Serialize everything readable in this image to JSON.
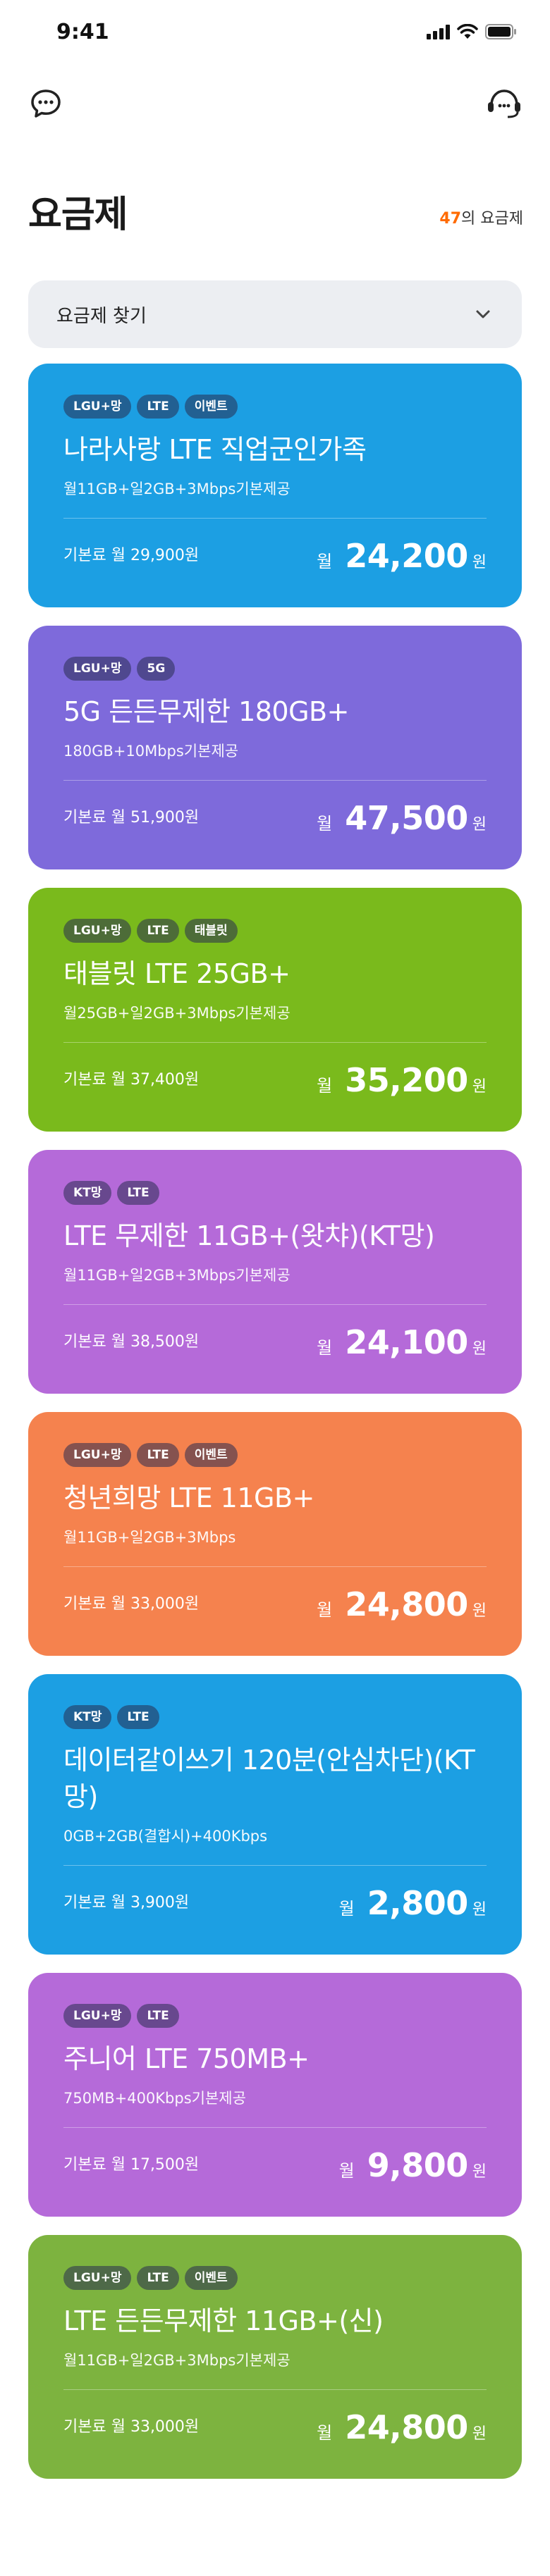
{
  "status_bar": {
    "time": "9:41"
  },
  "header": {
    "title": "요금제",
    "count_number": "47",
    "count_suffix": "의 요금제",
    "chat_icon": "chat-bubble-icon",
    "support_icon": "headset-icon"
  },
  "search": {
    "label": "요금제 찾기",
    "icon": "chevron-down-icon"
  },
  "colors": {
    "blue": "#1c9fe3",
    "purple": "#7e6adb",
    "green": "#7aba1c",
    "violet": "#b56ad9",
    "orange": "#f5824e",
    "olive": "#7db33f",
    "accent": "#ff6b00"
  },
  "plans": [
    {
      "tags": [
        "LGU+망",
        "LTE",
        "이벤트"
      ],
      "name": "나라사랑 LTE 직업군인가족",
      "desc": "월11GB+일2GB+3Mbps기본제공",
      "base_fee": "기본료 월 29,900원",
      "month": "월",
      "price": "24,200",
      "won": "원",
      "color": "#1c9fe3"
    },
    {
      "tags": [
        "LGU+망",
        "5G"
      ],
      "name": "5G 든든무제한 180GB+",
      "desc": "180GB+10Mbps기본제공",
      "base_fee": "기본료 월 51,900원",
      "month": "월",
      "price": "47,500",
      "won": "원",
      "color": "#7e6adb"
    },
    {
      "tags": [
        "LGU+망",
        "LTE",
        "태블릿"
      ],
      "name": "태블릿 LTE 25GB+",
      "desc": "월25GB+일2GB+3Mbps기본제공",
      "base_fee": "기본료 월 37,400원",
      "month": "월",
      "price": "35,200",
      "won": "원",
      "color": "#7aba1c"
    },
    {
      "tags": [
        "KT망",
        "LTE"
      ],
      "name": "LTE 무제한 11GB+(왓챠)(KT망)",
      "desc": "월11GB+일2GB+3Mbps기본제공",
      "base_fee": "기본료 월 38,500원",
      "month": "월",
      "price": "24,100",
      "won": "원",
      "color": "#b56ad9"
    },
    {
      "tags": [
        "LGU+망",
        "LTE",
        "이벤트"
      ],
      "name": "청년희망 LTE 11GB+",
      "desc": "월11GB+일2GB+3Mbps",
      "base_fee": "기본료 월 33,000원",
      "month": "월",
      "price": "24,800",
      "won": "원",
      "color": "#f5824e"
    },
    {
      "tags": [
        "KT망",
        "LTE"
      ],
      "name": "데이터같이쓰기 120분(안심차단)(KT망)",
      "desc": "0GB+2GB(결합시)+400Kbps",
      "base_fee": "기본료 월 3,900원",
      "month": "월",
      "price": "2,800",
      "won": "원",
      "color": "#1c9fe3"
    },
    {
      "tags": [
        "LGU+망",
        "LTE"
      ],
      "name": "주니어 LTE 750MB+",
      "desc": "750MB+400Kbps기본제공",
      "base_fee": "기본료 월 17,500원",
      "month": "월",
      "price": "9,800",
      "won": "원",
      "color": "#b56ad9"
    },
    {
      "tags": [
        "LGU+망",
        "LTE",
        "이벤트"
      ],
      "name": "LTE 든든무제한 11GB+(신)",
      "desc": "월11GB+일2GB+3Mbps기본제공",
      "base_fee": "기본료 월 33,000원",
      "month": "월",
      "price": "24,800",
      "won": "원",
      "color": "#7db33f"
    }
  ]
}
